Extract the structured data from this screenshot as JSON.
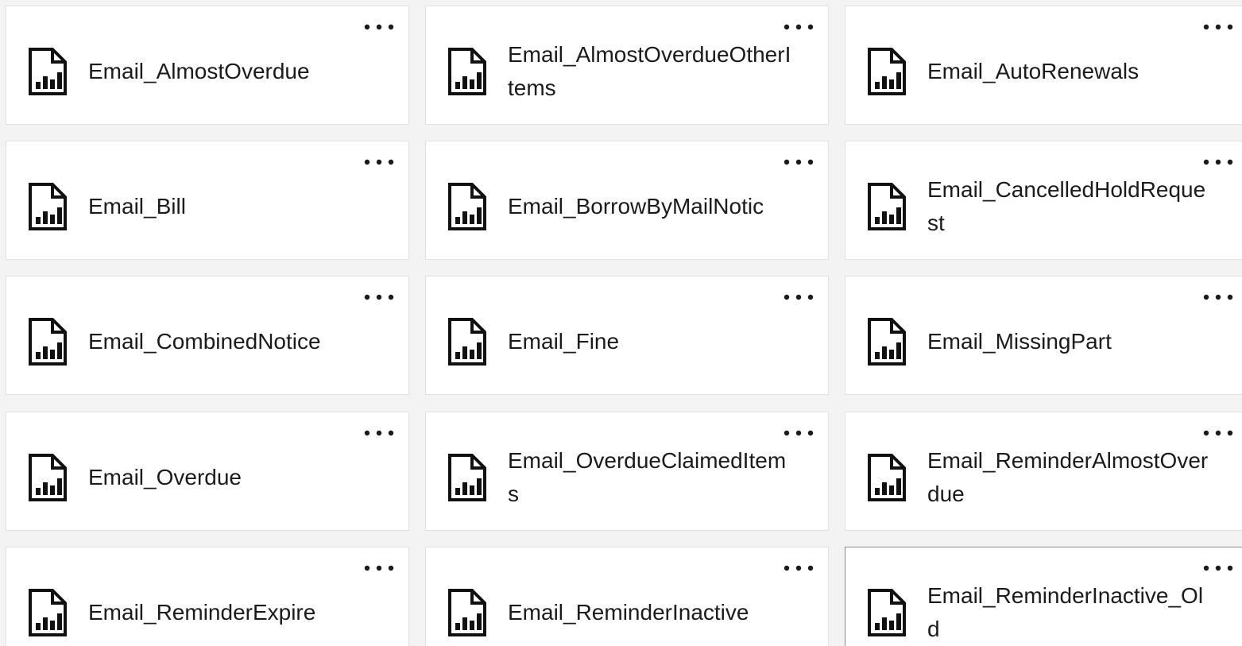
{
  "tiles": [
    {
      "name": "Email_AlmostOverdue"
    },
    {
      "name": "Email_AlmostOverdueOtherItems"
    },
    {
      "name": "Email_AutoRenewals"
    },
    {
      "name": "Email_Bill"
    },
    {
      "name": "Email_BorrowByMailNotic"
    },
    {
      "name": "Email_CancelledHoldRequest"
    },
    {
      "name": "Email_CombinedNotice"
    },
    {
      "name": "Email_Fine"
    },
    {
      "name": "Email_MissingPart"
    },
    {
      "name": "Email_Overdue"
    },
    {
      "name": "Email_OverdueClaimedItems"
    },
    {
      "name": "Email_ReminderAlmostOverdue"
    },
    {
      "name": "Email_ReminderExpire"
    },
    {
      "name": "Email_ReminderInactive"
    },
    {
      "name": "Email_ReminderInactive_Old",
      "selected": true
    }
  ],
  "icons": {
    "file": "report-file-icon",
    "more": "more-options-icon"
  }
}
